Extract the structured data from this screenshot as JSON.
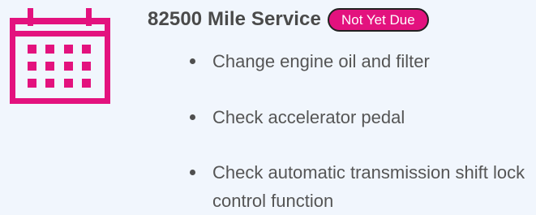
{
  "service": {
    "title": "82500 Mile Service",
    "status": "Not Yet Due",
    "icon": "calendar-icon",
    "colors": {
      "accent": "#e3127e",
      "background": "#f1f6fd",
      "text": "#4d4d4d"
    },
    "tasks": [
      "Change engine oil and filter",
      "Check accelerator pedal",
      "Check automatic transmission shift lock control function"
    ]
  }
}
